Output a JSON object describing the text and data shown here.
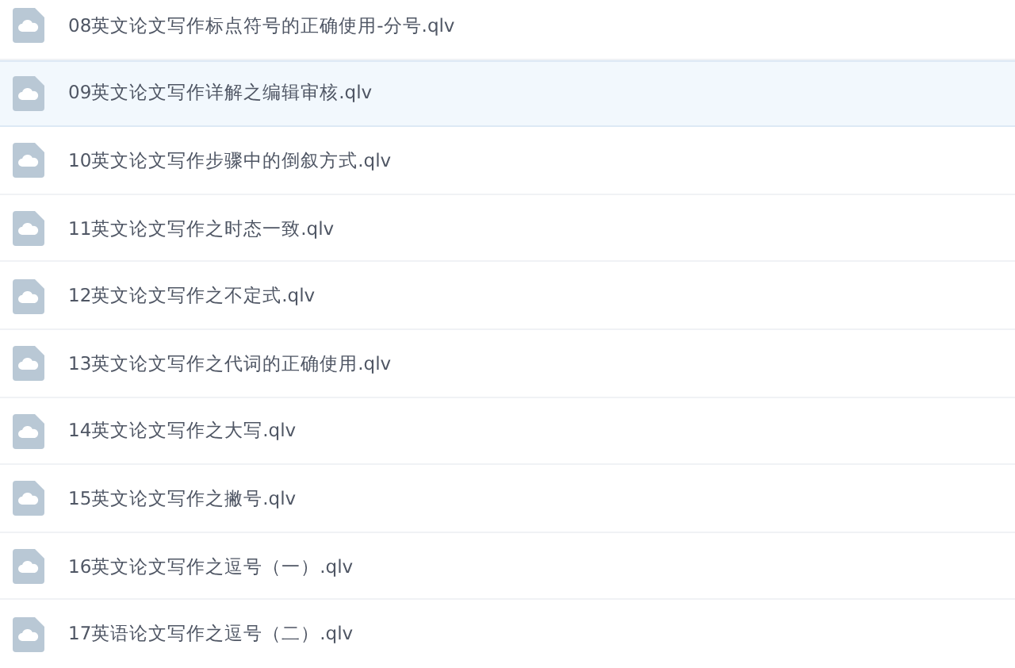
{
  "files": [
    {
      "name": "08英文论文写作标点符号的正确使用-分号.qlv",
      "selected": false
    },
    {
      "name": "09英文论文写作详解之编辑审核.qlv",
      "selected": true
    },
    {
      "name": "10英文论文写作步骤中的倒叙方式.qlv",
      "selected": false
    },
    {
      "name": "11英文论文写作之时态一致.qlv",
      "selected": false
    },
    {
      "name": "12英文论文写作之不定式.qlv",
      "selected": false
    },
    {
      "name": "13英文论文写作之代词的正确使用.qlv",
      "selected": false
    },
    {
      "name": "14英文论文写作之大写.qlv",
      "selected": false
    },
    {
      "name": "15英文论文写作之撇号.qlv",
      "selected": false
    },
    {
      "name": "16英文论文写作之逗号（一）.qlv",
      "selected": false
    },
    {
      "name": "17英语论文写作之逗号（二）.qlv",
      "selected": false
    }
  ]
}
